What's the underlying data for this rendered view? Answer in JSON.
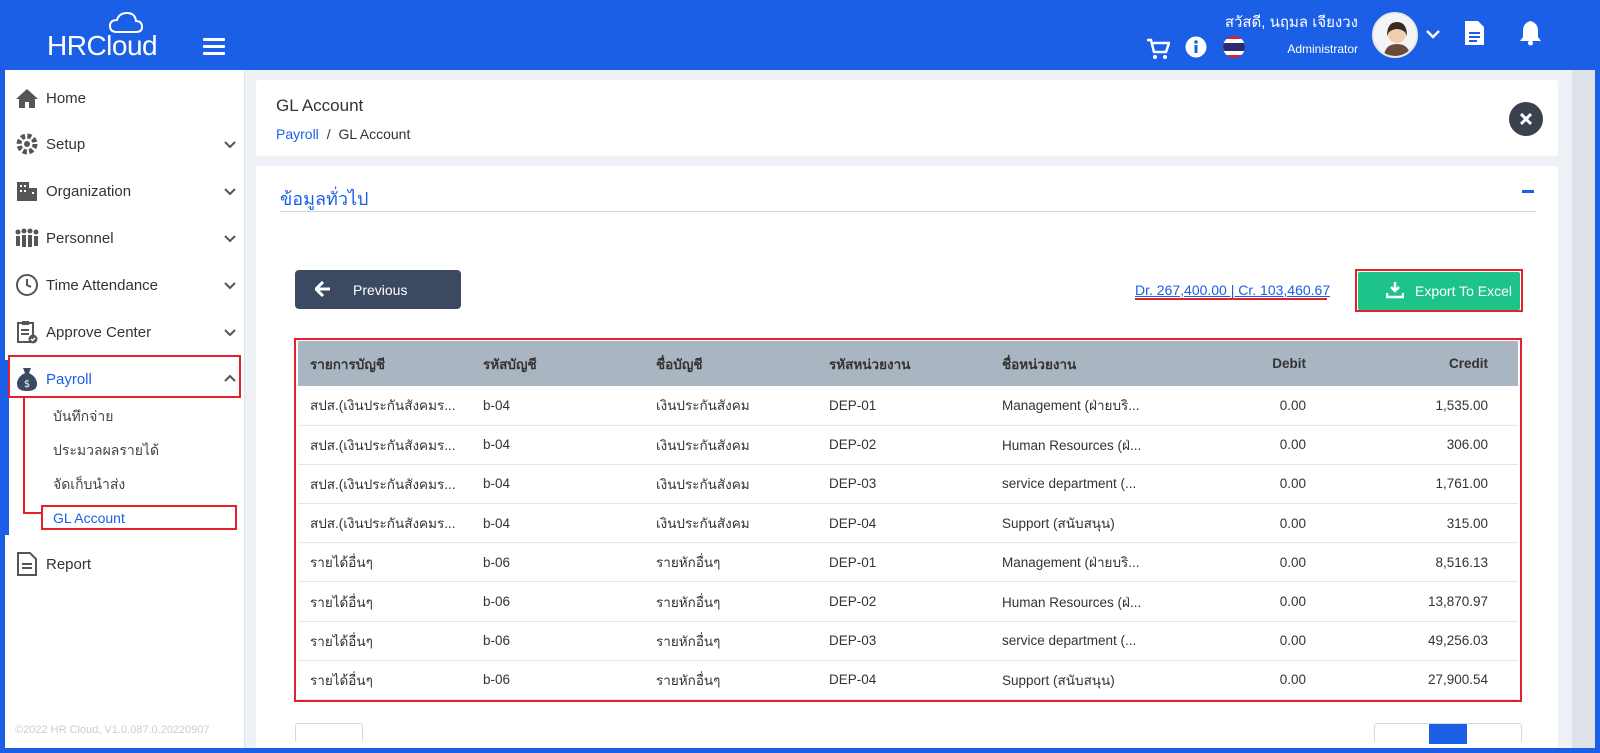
{
  "header": {
    "logo": "HRCloud",
    "greeting": "สวัสดี, นฤมล เจียงวง",
    "role": "Administrator"
  },
  "sidebar": {
    "items": [
      {
        "label": "Home"
      },
      {
        "label": "Setup"
      },
      {
        "label": "Organization"
      },
      {
        "label": "Personnel"
      },
      {
        "label": "Time Attendance"
      },
      {
        "label": "Approve Center"
      },
      {
        "label": "Payroll"
      },
      {
        "label": "Report"
      }
    ],
    "payroll_sub": [
      {
        "label": "บันทึกจ่าย"
      },
      {
        "label": "ประมวลผลรายได้"
      },
      {
        "label": "จัดเก็บนำส่ง"
      },
      {
        "label": "GL Account"
      }
    ],
    "copyright": "©2022 HR Cloud, V1.0.087.0.20220907"
  },
  "page": {
    "title": "GL Account",
    "breadcrumb_root": "Payroll",
    "breadcrumb_sep": "/",
    "breadcrumb_current": "GL Account"
  },
  "section": {
    "title": "ข้อมูลทั่วไป",
    "previous_label": "Previous",
    "totals": "Dr. 267,400.00 | Cr. 103,460.67",
    "export_label": "Export To Excel"
  },
  "table": {
    "headers": [
      "รายการบัญชี",
      "รหัสบัญชี",
      "ชื่อบัญชี",
      "รหัสหน่วยงาน",
      "ชื่อหน่วยงาน",
      "Debit",
      "Credit"
    ],
    "rows": [
      [
        "สปส.(เงินประกันสังคมร...",
        "b-04",
        "เงินประกันสังคม",
        "DEP-01",
        "Management (ฝ่ายบริ...",
        "0.00",
        "1,535.00"
      ],
      [
        "สปส.(เงินประกันสังคมร...",
        "b-04",
        "เงินประกันสังคม",
        "DEP-02",
        "Human Resources (ฝ่...",
        "0.00",
        "306.00"
      ],
      [
        "สปส.(เงินประกันสังคมร...",
        "b-04",
        "เงินประกันสังคม",
        "DEP-03",
        "service department (...",
        "0.00",
        "1,761.00"
      ],
      [
        "สปส.(เงินประกันสังคมร...",
        "b-04",
        "เงินประกันสังคม",
        "DEP-04",
        "Support (สนับสนุน)",
        "0.00",
        "315.00"
      ],
      [
        "รายได้อื่นๆ",
        "b-06",
        "รายหักอื่นๆ",
        "DEP-01",
        "Management (ฝ่ายบริ...",
        "0.00",
        "8,516.13"
      ],
      [
        "รายได้อื่นๆ",
        "b-06",
        "รายหักอื่นๆ",
        "DEP-02",
        "Human Resources (ฝ่...",
        "0.00",
        "13,870.97"
      ],
      [
        "รายได้อื่นๆ",
        "b-06",
        "รายหักอื่นๆ",
        "DEP-03",
        "service department (...",
        "0.00",
        "49,256.03"
      ],
      [
        "รายได้อื่นๆ",
        "b-06",
        "รายหักอื่นๆ",
        "DEP-04",
        "Support (สนับสนุน)",
        "0.00",
        "27,900.54"
      ]
    ]
  },
  "colors": {
    "primary": "#1a5fe6",
    "export": "#1ec38a",
    "highlight": "#e4202b",
    "table_header": "#aab5c2",
    "previous_button": "#3c4a61"
  }
}
